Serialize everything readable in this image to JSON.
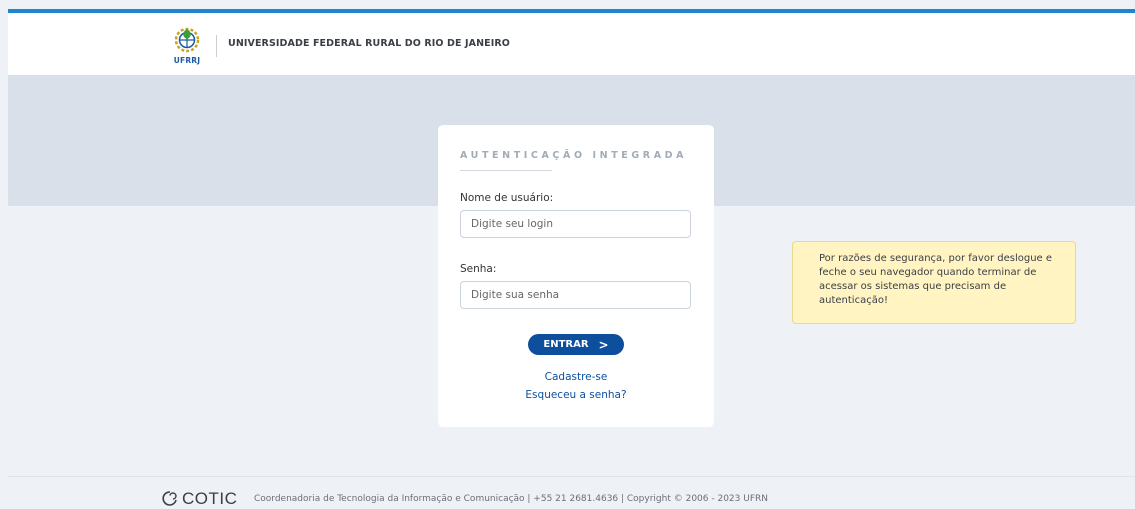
{
  "header": {
    "logo_text": "UFRRJ",
    "title": "UNIVERSIDADE FEDERAL RURAL DO RIO DE JANEIRO"
  },
  "login": {
    "title": "AUTENTICAÇÃO INTEGRADA",
    "username_label": "Nome de usuário:",
    "username_placeholder": "Digite seu login",
    "username_value": "",
    "password_label": "Senha:",
    "password_placeholder": "Digite sua senha",
    "password_value": "",
    "submit_label": "ENTRAR",
    "submit_icon": "chevron-right-icon",
    "register_link": "Cadastre-se",
    "forgot_link": "Esqueceu a senha?"
  },
  "security_note": "Por razões de segurança, por favor deslogue e feche o seu navegador quando terminar de acessar os sistemas que precisam de autenticação!",
  "footer": {
    "logo_text": "COTIC",
    "text": "Coordenadoria de Tecnologia da Informação e Comunicação | +55 21 2681.4636 | Copyright © 2006 - 2023 UFRN"
  },
  "colors": {
    "accent_bar": "#1e86d0",
    "primary_button": "#0d4f9c",
    "link": "#0d4f9c",
    "band": "#d9e0e9",
    "page_bg": "#eef2f6",
    "note_bg": "#fff4c2"
  }
}
